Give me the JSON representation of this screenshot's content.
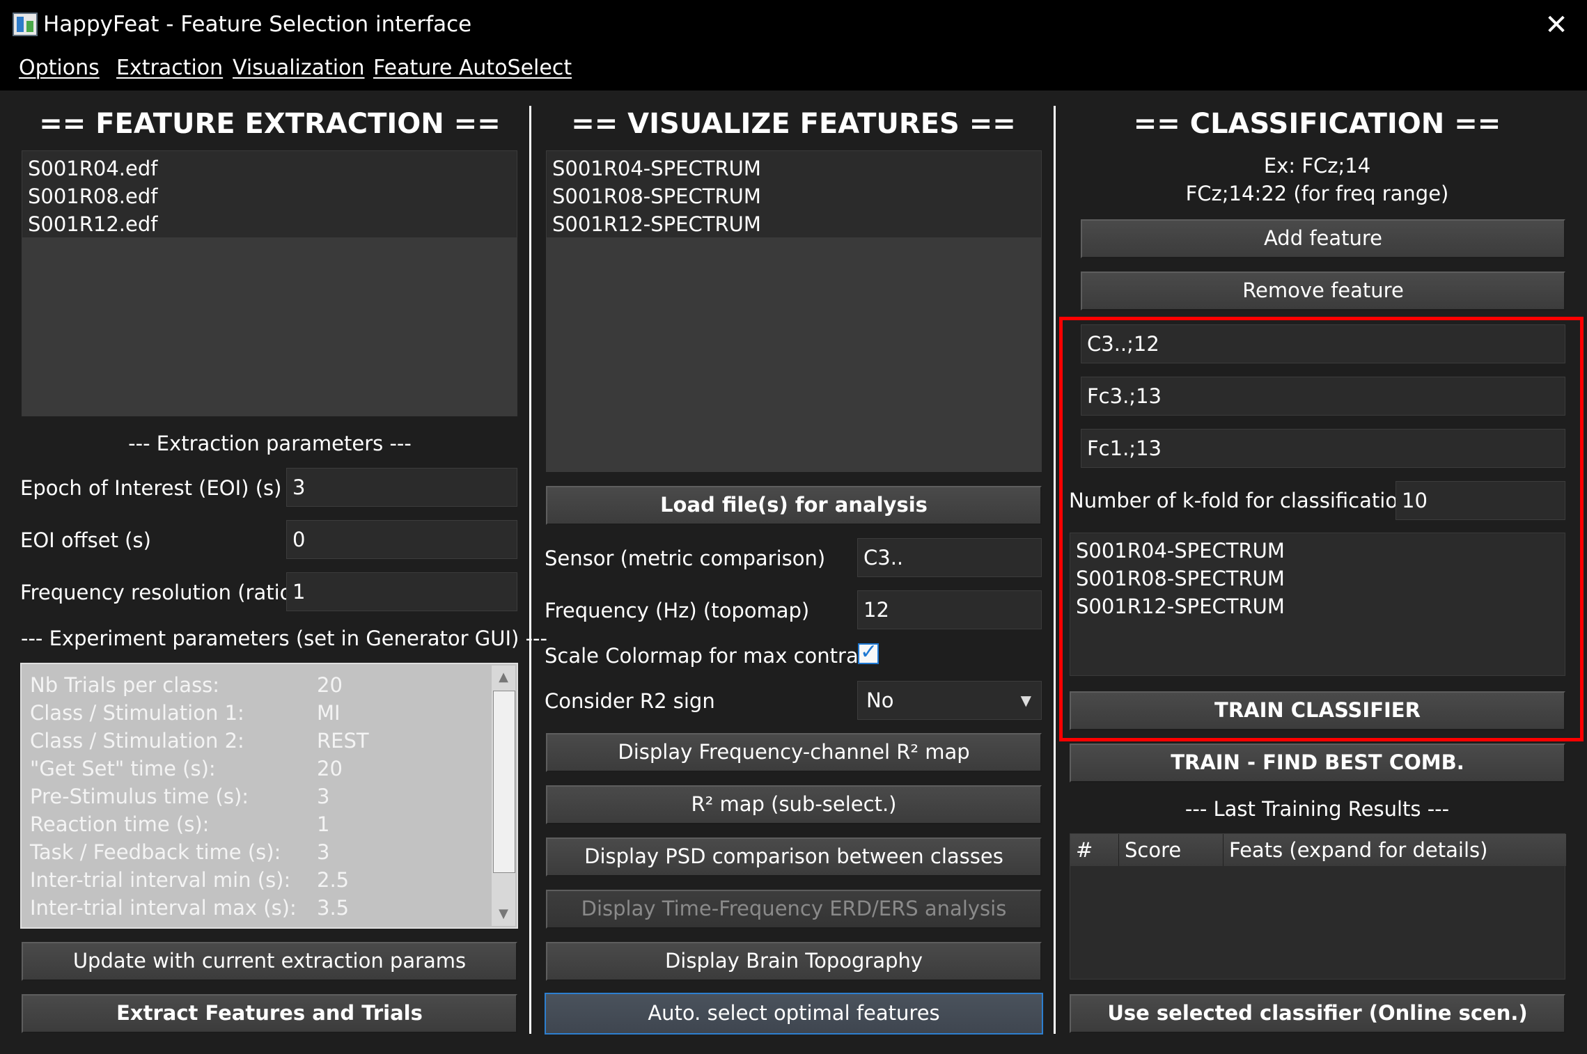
{
  "window": {
    "title": "HappyFeat - Feature Selection interface",
    "close_glyph": "✕"
  },
  "menu": [
    "Options",
    "Extraction",
    "Visualization",
    "Feature AutoSelect"
  ],
  "extraction": {
    "heading": "== FEATURE EXTRACTION ==",
    "files": [
      "S001R04.edf",
      "S001R08.edf",
      "S001R12.edf"
    ],
    "params_label": "--- Extraction parameters ---",
    "eoi_label": "Epoch of Interest (EOI) (s)",
    "eoi_value": "3",
    "eoi_offset_label": "EOI offset (s)",
    "eoi_offset_value": "0",
    "freq_res_label": "Frequency resolution (ratio)",
    "freq_res_value": "1",
    "exp_params_label": "--- Experiment parameters (set in Generator GUI) ---",
    "exp_params": [
      {
        "label": "Nb Trials per class:",
        "value": "20"
      },
      {
        "label": "Class / Stimulation 1:",
        "value": "MI"
      },
      {
        "label": "Class / Stimulation 2:",
        "value": "REST"
      },
      {
        "label": "\"Get Set\" time (s):",
        "value": "20"
      },
      {
        "label": "Pre-Stimulus time (s):",
        "value": "3"
      },
      {
        "label": "Reaction time (s):",
        "value": "1"
      },
      {
        "label": "Task / Feedback time (s):",
        "value": "3"
      },
      {
        "label": "Inter-trial interval min (s):",
        "value": "2.5"
      },
      {
        "label": "Inter-trial interval max (s):",
        "value": "3.5"
      }
    ],
    "update_button": "Update with current extraction params",
    "extract_button": "Extract Features and Trials"
  },
  "visualize": {
    "heading": "== VISUALIZE FEATURES ==",
    "files": [
      "S001R04-SPECTRUM",
      "S001R08-SPECTRUM",
      "S001R12-SPECTRUM"
    ],
    "load_button": "Load file(s) for analysis",
    "sensor_label": "Sensor (metric comparison)",
    "sensor_value": "C3..",
    "freq_label": "Frequency (Hz) (topomap)",
    "freq_value": "12",
    "colormap_label": "Scale Colormap for max contrast",
    "colormap_checked": true,
    "r2sign_label": "Consider R2 sign",
    "r2sign_value": "No",
    "buttons": [
      "Display Frequency-channel R² map",
      "R² map (sub-select.)",
      "Display PSD comparison between classes",
      "Display Time-Frequency ERD/ERS analysis",
      "Display Brain Topography",
      "Auto. select optimal features"
    ]
  },
  "classification": {
    "heading": "== CLASSIFICATION ==",
    "hint1": "Ex: FCz;14",
    "hint2": "FCz;14:22 (for freq range)",
    "add_button": "Add feature",
    "remove_button": "Remove feature",
    "features": [
      "C3..;12",
      "Fc3.;13",
      "Fc1.;13"
    ],
    "kfold_label": "Number of k-fold for classification",
    "kfold_value": "10",
    "files": [
      "S001R04-SPECTRUM",
      "S001R08-SPECTRUM",
      "S001R12-SPECTRUM"
    ],
    "train_button": "TRAIN CLASSIFIER",
    "train_best_button": "TRAIN - FIND BEST COMB.",
    "results_label": "--- Last Training Results ---",
    "results_columns": [
      "#",
      "Score",
      "Feats (expand for details)"
    ],
    "use_button": "Use selected classifier (Online scen.)"
  },
  "colors": {
    "background": "#1e1e1e",
    "highlight": "#ff0000",
    "focus": "#2d7fd0"
  }
}
